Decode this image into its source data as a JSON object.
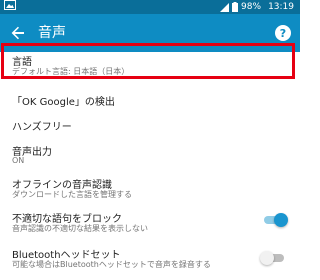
{
  "status_bar": {
    "battery_percent": "98%",
    "time": "13:19"
  },
  "app_bar": {
    "title": "音声"
  },
  "items": [
    {
      "title": "言語",
      "subtitle": "デフォルト言語: 日本語（日本）"
    },
    {
      "title": "「OK Google」の検出"
    },
    {
      "title": "ハンズフリー"
    },
    {
      "title": "音声出力",
      "subtitle": "ON"
    },
    {
      "title": "オフラインの音声認識",
      "subtitle": "ダウンロードした言語を管理する"
    },
    {
      "title": "不適切な語句をブロック",
      "subtitle": "音声認識の不適切な結果を表示しない",
      "toggle": true
    },
    {
      "title": "Bluetoothヘッドセット",
      "subtitle": "可能な場合はBluetoothヘッドセットで音声を録音する",
      "toggle": false
    }
  ],
  "colors": {
    "status_bar": "#0a6e99",
    "app_bar": "#0e8cc3",
    "highlight_border": "#e60012",
    "toggle_on": "#1a95cf"
  }
}
